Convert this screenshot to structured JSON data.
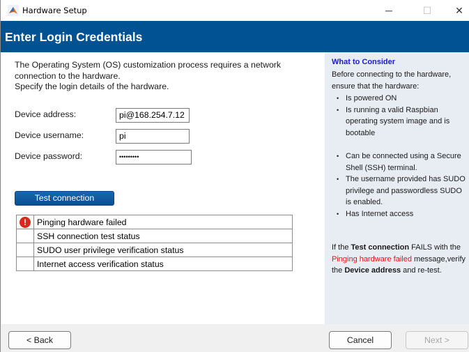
{
  "window": {
    "title": "Hardware Setup",
    "controls": {
      "minimize": "─",
      "maximize": "☐",
      "close": "✕"
    }
  },
  "header": {
    "title": "Enter Login Credentials"
  },
  "main": {
    "intro_line1": "The Operating System (OS) customization process requires a network connection to the hardware.",
    "intro_line2": "Specify the login details of the hardware.",
    "fields": [
      {
        "label": "Device address:",
        "value": "pi@168.254.7.12"
      },
      {
        "label": "Device username:",
        "value": "pi"
      },
      {
        "label": "Device password:",
        "value": "•••••••••"
      }
    ],
    "test_button": "Test connection",
    "status_rows": [
      {
        "icon": "error-icon",
        "icon_glyph": "!",
        "text": "Pinging hardware failed"
      },
      {
        "icon": "",
        "icon_glyph": "",
        "text": "SSH connection test status"
      },
      {
        "icon": "",
        "icon_glyph": "",
        "text": "SUDO user privilege verification status"
      },
      {
        "icon": "",
        "icon_glyph": "",
        "text": "Internet access verification status"
      }
    ]
  },
  "side": {
    "title": "What to Consider",
    "intro": "Before connecting to the hardware, ensure that the hardware:",
    "list1": [
      "Is powered ON",
      "Is running a valid Raspbian operating system image and is bootable"
    ],
    "list2": [
      "Can be connected using a Secure Shell (SSH) terminal.",
      "The username provided has SUDO privilege and passwordless SUDO is enabled.",
      "Has Internet access"
    ],
    "note": {
      "part1": "If the ",
      "bold1": "Test connection",
      "part2": " FAILS with the ",
      "red": "Pinging hardware failed",
      "part3": " message,verify the ",
      "bold2": "Device address",
      "part4": " and re-test."
    },
    "colors": {
      "title": "#1a1ad0",
      "error": "#e8101a",
      "background": "#e8edf4"
    }
  },
  "footer": {
    "back": "< Back",
    "cancel": "Cancel",
    "next": "Next >"
  },
  "colors": {
    "header": "#005293",
    "button": "#0e5ba3"
  }
}
